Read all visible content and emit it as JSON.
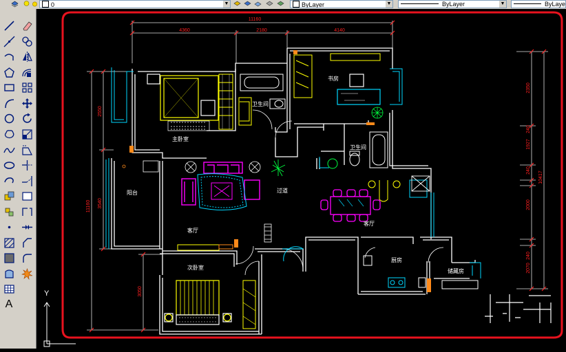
{
  "properties_bar": {
    "layer_value": "0",
    "color_value": "ByLayer",
    "linetype_value": "ByLayer",
    "lineweight_value": "ByLaye"
  },
  "toolbar_draw": [
    "line-icon",
    "construction-line-icon",
    "polyline-icon",
    "polygon-icon",
    "rectangle-icon",
    "arc-icon",
    "circle-icon",
    "revision-cloud-icon",
    "spline-icon",
    "ellipse-icon",
    "ellipse-arc-icon",
    "insert-block-icon",
    "make-block-icon",
    "point-icon",
    "hatch-icon",
    "gradient-icon",
    "region-icon",
    "table-icon",
    "multiline-text-icon"
  ],
  "toolbar_modify": [
    "erase-icon",
    "copy-icon",
    "mirror-icon",
    "offset-icon",
    "array-icon",
    "move-icon",
    "rotate-icon",
    "scale-icon",
    "stretch-icon",
    "trim-icon",
    "extend-icon",
    "break-at-point-icon",
    "break-icon",
    "join-icon",
    "chamfer-icon",
    "fillet-icon",
    "explode-icon"
  ],
  "drawing": {
    "dimensions": {
      "top_total": "11160",
      "top_seg1": "4360",
      "top_seg2": "2180",
      "top_seg3": "4140",
      "left_total": "11160",
      "left_seg1": "2550",
      "left_seg2": "3540",
      "left_seg3": "3050",
      "right_seg1": "2350",
      "right_seg2": "240",
      "right_seg3": "1927",
      "right_seg4": "240",
      "right_seg5": "2000",
      "right_seg6": "240",
      "right_seg7": "2070",
      "right_total": "10417"
    },
    "rooms": {
      "master_bedroom": "主卧室",
      "bathroom_1": "卫生间",
      "study": "书房",
      "bathroom_2": "卫生间",
      "balcony": "阳台",
      "corridor": "过道",
      "living_room": "客厅",
      "dining_room": "客厅",
      "second_bedroom": "次卧室",
      "kitchen": "厨房",
      "storage_room": "储藏房"
    },
    "ucs_axis_label": "Y",
    "colors": {
      "wall": "#ffffff",
      "window": "#00d7ff",
      "dimension": "#ff2020",
      "furniture_yellow": "#ffff00",
      "furniture_magenta": "#ff00ff",
      "plant_green": "#00ff40",
      "highlight_outline": "#e8121e"
    }
  }
}
